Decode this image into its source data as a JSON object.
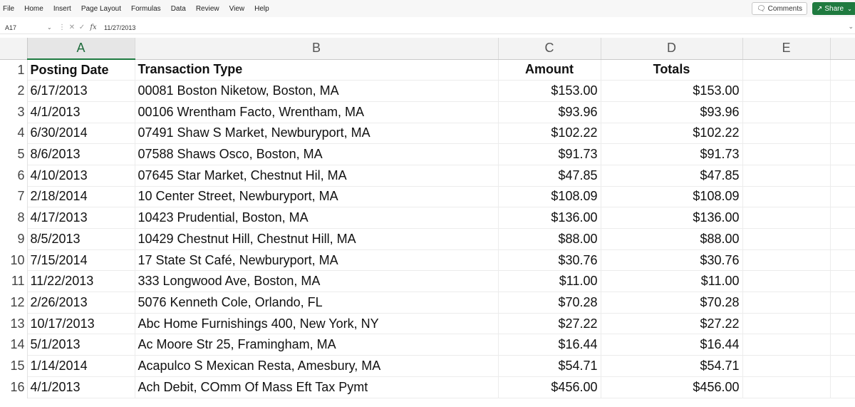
{
  "menu": [
    "File",
    "Home",
    "Insert",
    "Page Layout",
    "Formulas",
    "Data",
    "Review",
    "View",
    "Help"
  ],
  "toolbar": {
    "comments_label": "Comments",
    "share_label": "Share"
  },
  "formula_bar": {
    "name_box": "A17",
    "formula": "11/27/2013"
  },
  "grid": {
    "columns": [
      "A",
      "B",
      "C",
      "D",
      "E"
    ],
    "headers": {
      "a": "Posting Date",
      "b": "Transaction Type",
      "c": "Amount",
      "d": "Totals"
    },
    "rows": [
      {
        "n": "1"
      },
      {
        "n": "2",
        "date": "6/17/2013",
        "type": "00081 Boston Niketow, Boston, MA",
        "amount": "$153.00",
        "total": "$153.00"
      },
      {
        "n": "3",
        "date": "4/1/2013",
        "type": "00106 Wrentham Facto, Wrentham, MA",
        "amount": "$93.96",
        "total": "$93.96"
      },
      {
        "n": "4",
        "date": "6/30/2014",
        "type": "07491 Shaw S Market, Newburyport, MA",
        "amount": "$102.22",
        "total": "$102.22"
      },
      {
        "n": "5",
        "date": "8/6/2013",
        "type": "07588 Shaws Osco, Boston, MA",
        "amount": "$91.73",
        "total": "$91.73"
      },
      {
        "n": "6",
        "date": "4/10/2013",
        "type": "07645 Star Market, Chestnut Hil, MA",
        "amount": "$47.85",
        "total": "$47.85"
      },
      {
        "n": "7",
        "date": "2/18/2014",
        "type": "10 Center Street, Newburyport, MA",
        "amount": "$108.09",
        "total": "$108.09"
      },
      {
        "n": "8",
        "date": "4/17/2013",
        "type": "10423 Prudential, Boston, MA",
        "amount": "$136.00",
        "total": "$136.00"
      },
      {
        "n": "9",
        "date": "8/5/2013",
        "type": "10429 Chestnut Hill, Chestnut Hill, MA",
        "amount": "$88.00",
        "total": "$88.00"
      },
      {
        "n": "10",
        "date": "7/15/2014",
        "type": "17 State St Café, Newburyport, MA",
        "amount": "$30.76",
        "total": "$30.76"
      },
      {
        "n": "11",
        "date": "11/22/2013",
        "type": "333 Longwood Ave, Boston, MA",
        "amount": "$11.00",
        "total": "$11.00"
      },
      {
        "n": "12",
        "date": "2/26/2013",
        "type": "5076 Kenneth Cole, Orlando, FL",
        "amount": "$70.28",
        "total": "$70.28"
      },
      {
        "n": "13",
        "date": "10/17/2013",
        "type": "Abc Home Furnishings 400, New York, NY",
        "amount": "$27.22",
        "total": "$27.22"
      },
      {
        "n": "14",
        "date": "5/1/2013",
        "type": "Ac Moore Str 25, Framingham, MA",
        "amount": "$16.44",
        "total": "$16.44"
      },
      {
        "n": "15",
        "date": "1/14/2014",
        "type": "Acapulco S Mexican Resta, Amesbury, MA",
        "amount": "$54.71",
        "total": "$54.71"
      },
      {
        "n": "16",
        "date": "4/1/2013",
        "type": "Ach Debit, COmm Of Mass Eft Tax Pymt",
        "amount": "$456.00",
        "total": "$456.00"
      }
    ]
  },
  "colors": {
    "accent": "#1e7a40",
    "share_bg": "#1f7a3f"
  }
}
